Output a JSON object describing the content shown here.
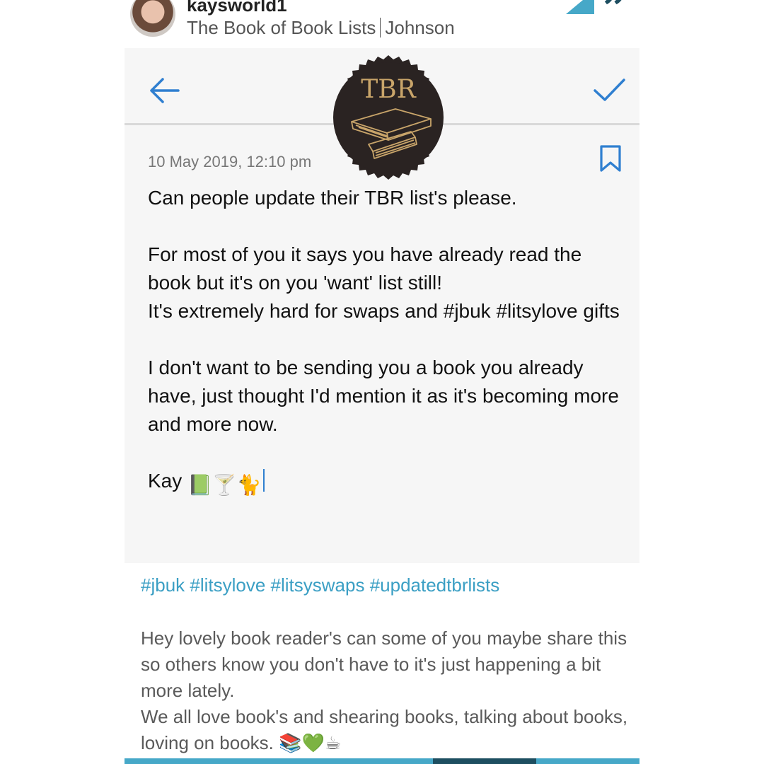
{
  "post": {
    "username": "kaysworld1",
    "book_title": "The Book of Book Lists",
    "book_author": "Johnson"
  },
  "composer": {
    "badge_text": "TBR",
    "timestamp": "10 May 2019, 12:10 pm",
    "lines": [
      "Can people update their TBR list's please.",
      "",
      "For most of you it says you have already read the book but it's on you 'want' list still!",
      "It's extremely hard for swaps and #jbuk #litsylove gifts",
      "",
      "I don't want to be sending you a book you already have, just thought I'd mention it as it's becoming more and more now.",
      ""
    ],
    "signature": "Kay",
    "signature_emojis": "📗🍸🐈"
  },
  "caption": {
    "hashtags": "#jbuk #litsylove #litsyswaps #updatedtbrlists",
    "lines": [
      "Hey lovely book reader's can some of you maybe share this so others know you don't have to it's just happening a bit more lately.",
      "We all love book's and shearing books, talking about books, loving on books. 📚💚☕"
    ]
  },
  "colors": {
    "accent": "#46a8c8",
    "accent_dark": "#1d4e60",
    "icon_blue": "#2f7fd0",
    "badge_bg": "#2a2322",
    "badge_gold": "#c9a56a"
  },
  "icons": [
    "avatar",
    "quote-icon",
    "back-arrow-icon",
    "checkmark-icon",
    "tbr-badge-logo",
    "bookmark-icon"
  ]
}
